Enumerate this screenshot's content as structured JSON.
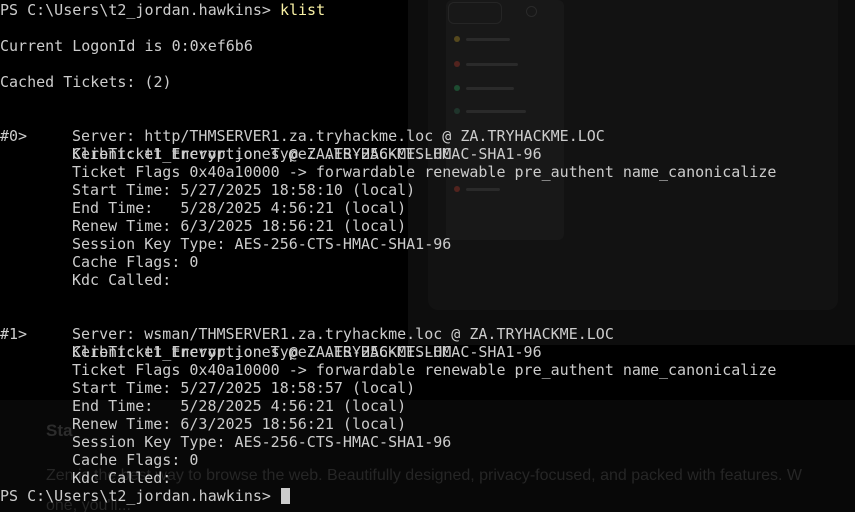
{
  "prompt": {
    "text": "PS C:\\Users\\t2_jordan.hawkins> ",
    "command": "klist"
  },
  "logon_line": "Current LogonId is 0:0xef6b6",
  "cached_tickets_line": "Cached Tickets: (2)",
  "tickets": [
    {
      "id": "#0>",
      "client": "Client: t1_trevor.jones @ ZA.TRYHACKME.LOC",
      "server": "Server: http/THMSERVER1.za.tryhackme.loc @ ZA.TRYHACKME.LOC",
      "encryption": "KerbTicket Encryption Type: AES-256-CTS-HMAC-SHA1-96",
      "flags": "Ticket Flags 0x40a10000 -> forwardable renewable pre_authent name_canonicalize",
      "start_time": "Start Time: 5/27/2025 18:58:10 (local)",
      "end_time": "End Time:   5/28/2025 4:56:21 (local)",
      "renew_time": "Renew Time: 6/3/2025 18:56:21 (local)",
      "session_key": "Session Key Type: AES-256-CTS-HMAC-SHA1-96",
      "cache_flags": "Cache Flags: 0",
      "kdc_called": "Kdc Called:"
    },
    {
      "id": "#1>",
      "client": "Client: t1_trevor.jones @ ZA.TRYHACKME.LOC",
      "server": "Server: wsman/THMSERVER1.za.tryhackme.loc @ ZA.TRYHACKME.LOC",
      "encryption": "KerbTicket Encryption Type: AES-256-CTS-HMAC-SHA1-96",
      "flags": "Ticket Flags 0x40a10000 -> forwardable renewable pre_authent name_canonicalize",
      "start_time": "Start Time: 5/27/2025 18:58:57 (local)",
      "end_time": "End Time:   5/28/2025 4:56:21 (local)",
      "renew_time": "Renew Time: 6/3/2025 18:56:21 (local)",
      "session_key": "Session Key Type: AES-256-CTS-HMAC-SHA1-96",
      "cache_flags": "Cache Flags: 0",
      "kdc_called": "Kdc Called:"
    }
  ],
  "final_prompt": "PS C:\\Users\\t2_jordan.hawkins> ",
  "background": {
    "heading": "Sta",
    "tagline": "Zen is the best way to browse the web. Beautifully designed, privacy-focused, and packed with features. W",
    "tagline_2": "one, you'll..."
  },
  "colors": {
    "terminal_bg": "#000000",
    "terminal_text": "#cccccc",
    "command_text": "#f9f1a5"
  }
}
